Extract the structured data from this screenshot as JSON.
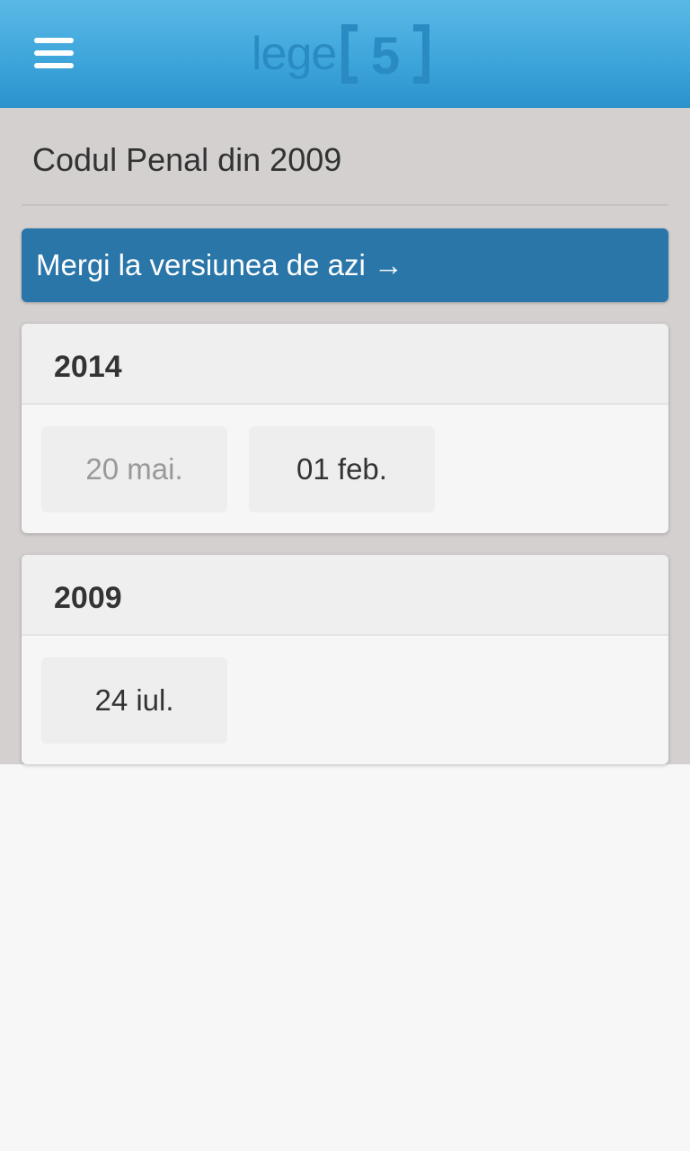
{
  "header": {
    "menu_icon": "hamburger-menu-icon",
    "logo": {
      "word": "lege",
      "number": "5",
      "color": "#2a8bc3"
    }
  },
  "main": {
    "title": "Codul Penal din 2009",
    "today_button": "Mergi la versiunea de azi →",
    "years": [
      {
        "year": "2014",
        "dates": [
          {
            "label": "20 mai.",
            "state": "current"
          },
          {
            "label": "01 feb.",
            "state": "available"
          }
        ]
      },
      {
        "year": "2009",
        "dates": [
          {
            "label": "24 iul.",
            "state": "available"
          }
        ]
      }
    ]
  },
  "colors": {
    "header_top": "#5bb8e6",
    "header_bottom": "#2b92cc",
    "accent_button": "#2a76a9",
    "content_background": "#d4d0d0",
    "muted_text": "#999999"
  }
}
